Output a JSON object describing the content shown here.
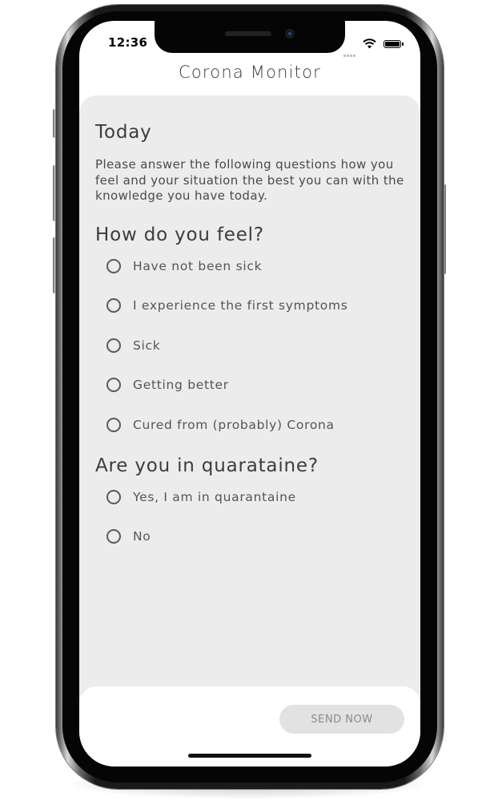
{
  "status_bar": {
    "time": "12:36"
  },
  "app": {
    "title": "Corona Monitor"
  },
  "today": {
    "heading": "Today",
    "intro": "Please answer the following questions how you feel and your situation the best you can with the knowledge you have today."
  },
  "feel": {
    "heading": "How do you feel?",
    "options": [
      "Have not been sick",
      "I experience the first symptoms",
      "Sick",
      "Getting better",
      "Cured from (probably) Corona"
    ]
  },
  "quarantine": {
    "heading": "Are you in quarataine?",
    "options": [
      "Yes, I am in quarantaine",
      "No"
    ]
  },
  "actions": {
    "send_label": "SEND NOW"
  }
}
